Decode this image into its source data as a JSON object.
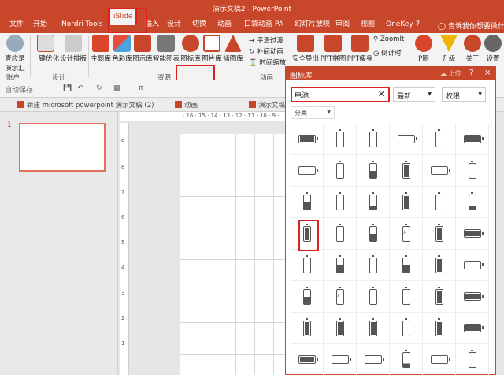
{
  "window": {
    "title": "演示文稿2 - PowerPoint"
  },
  "tabs": [
    "文件",
    "开始",
    "Nordri Tools",
    "iSlide",
    "插入",
    "设计",
    "切换",
    "动画",
    "口袋动画 PA",
    "幻灯片放映",
    "审阅",
    "视图",
    "OneKey 7"
  ],
  "tell_me": "告诉我你想要做什么",
  "ribbon": {
    "account": {
      "label1": "壹应是",
      "label2": "演示汇",
      "group": "账户"
    },
    "design_items": [
      "一键优化",
      "设计排版"
    ],
    "design_group": "设计",
    "resource_items": [
      "主题库",
      "色彩库",
      "图示库",
      "智能图表",
      "图标库",
      "图片库",
      "插图库"
    ],
    "resource_group": "资源",
    "anim_items": [
      "平滑过渡",
      "补间动画",
      "时间缩放"
    ],
    "anim_group": "动画",
    "tools_items": [
      "安全导出",
      "PPT拼图",
      "PPT瘦身",
      "ZoomIt",
      "倒计时",
      "P圈",
      "升级",
      "关于",
      "设置"
    ]
  },
  "qat": {
    "autosave": "自动保存",
    "zoom_label": "π"
  },
  "doc_tabs": [
    "新建 microsoft powerpoint 演示文稿 (2)",
    "动画",
    "演示文稿2"
  ],
  "slide_panel": {
    "slide_number": "1"
  },
  "ruler": {
    "h_ticks": "· 16 · 15 · 14 · 13 · 12 · 11 · 10 · 9 ·",
    "v_ticks": [
      "9",
      "8",
      "7",
      "6",
      "5",
      "4",
      "3",
      "2",
      "1"
    ]
  },
  "icon_library": {
    "title": "图标库",
    "upload": "上传",
    "help": "?",
    "close": "×",
    "search_value": "电池",
    "sort_option": "最新",
    "permission_option": "权限",
    "category_label": "分类"
  },
  "colors": {
    "accent": "#c8472a",
    "highlight": "#e02020"
  },
  "icon_grid": [
    [
      "battery-h-full",
      "battery-m",
      "battery-m",
      "battery-h",
      "camera-battery",
      "battery-h-full"
    ],
    [
      "battery-h-low",
      "battery-v",
      "battery-v-half",
      "battery-v-full",
      "battery-h-charge",
      "battery-v"
    ],
    [
      "battery-v-half",
      "battery-v",
      "battery-v-low",
      "battery-v-full",
      "battery-v",
      "battery-v-low"
    ],
    [
      "battery-v-full",
      "battery-v",
      "battery-v-half",
      "battery-v-bolt",
      "battery-v-full",
      "battery-h-full"
    ],
    [
      "battery-v",
      "battery-v-half",
      "battery-v",
      "battery-v-half",
      "battery-v-full",
      "battery-h-charge"
    ],
    [
      "battery-v-half",
      "battery-v-bolt",
      "battery-v",
      "battery-v",
      "battery-v-full",
      "battery-h-full"
    ],
    [
      "battery-v-full",
      "battery-v-full",
      "battery-v-full",
      "battery-v",
      "battery-v-full",
      "battery-h-full"
    ],
    [
      "battery-h-full",
      "battery-h",
      "battery-h",
      "battery-v-low",
      "battery-h",
      "battery-v"
    ]
  ]
}
